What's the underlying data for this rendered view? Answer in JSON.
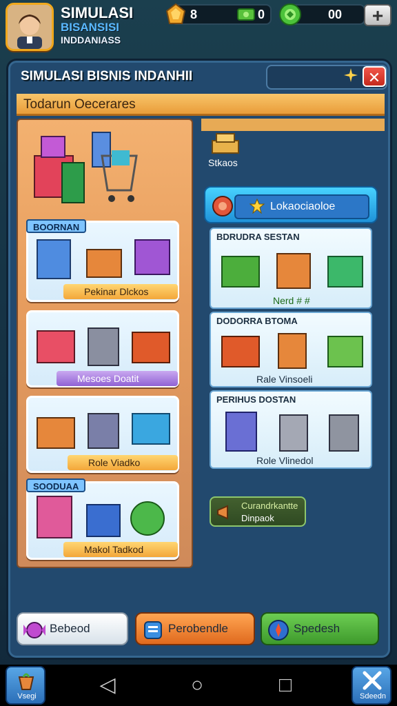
{
  "hud": {
    "title": "SIMULASI",
    "subtitle1": "BISANSISI",
    "subtitle2": "INDDANIASS",
    "resource_gold": "8",
    "resource_cash": "0",
    "resource_gems": "00",
    "plus_label": "+"
  },
  "panel": {
    "title": "SIMULASI BISNIS INDANHII",
    "close_label": "✕",
    "banner": "Todarun Oecerares"
  },
  "left_cards": [
    {
      "section": "BOORNAN",
      "label": "Pekinar Dlckos"
    },
    {
      "section": "",
      "label": "Mesoes Doatit"
    },
    {
      "section": "",
      "label": "Role Viadko"
    },
    {
      "section": "SOODUAA",
      "label": "Makol Tadkod"
    }
  ],
  "right_panel": {
    "stock_label": "Stkaos",
    "lok_button": "Lokaociaoloe",
    "cards": [
      {
        "title": "BDRUDRA SESTAN",
        "label": "Nerd # #"
      },
      {
        "title": "DODORRA BTOMA",
        "label": "Rale Vinsoeli"
      },
      {
        "title": "PERIHUS DOSTAN",
        "label": "Role Vlinedol"
      }
    ],
    "currency_button_line1": "Curandrkantte",
    "currency_button_line2": "Dinpaok"
  },
  "bottom": {
    "btn1": "Bebeod",
    "btn2": "Perobendle",
    "btn3": "Spedesh"
  },
  "nav": {
    "left_label": "Vsegi",
    "right_label": "Sdeedn",
    "back_icon": "◁",
    "home_icon": "○",
    "recent_icon": "□"
  },
  "colors": {
    "accent_orange": "#f3a73a",
    "accent_blue": "#1f92d8",
    "accent_green": "#4cae3c",
    "panel_bg": "#22496e"
  }
}
